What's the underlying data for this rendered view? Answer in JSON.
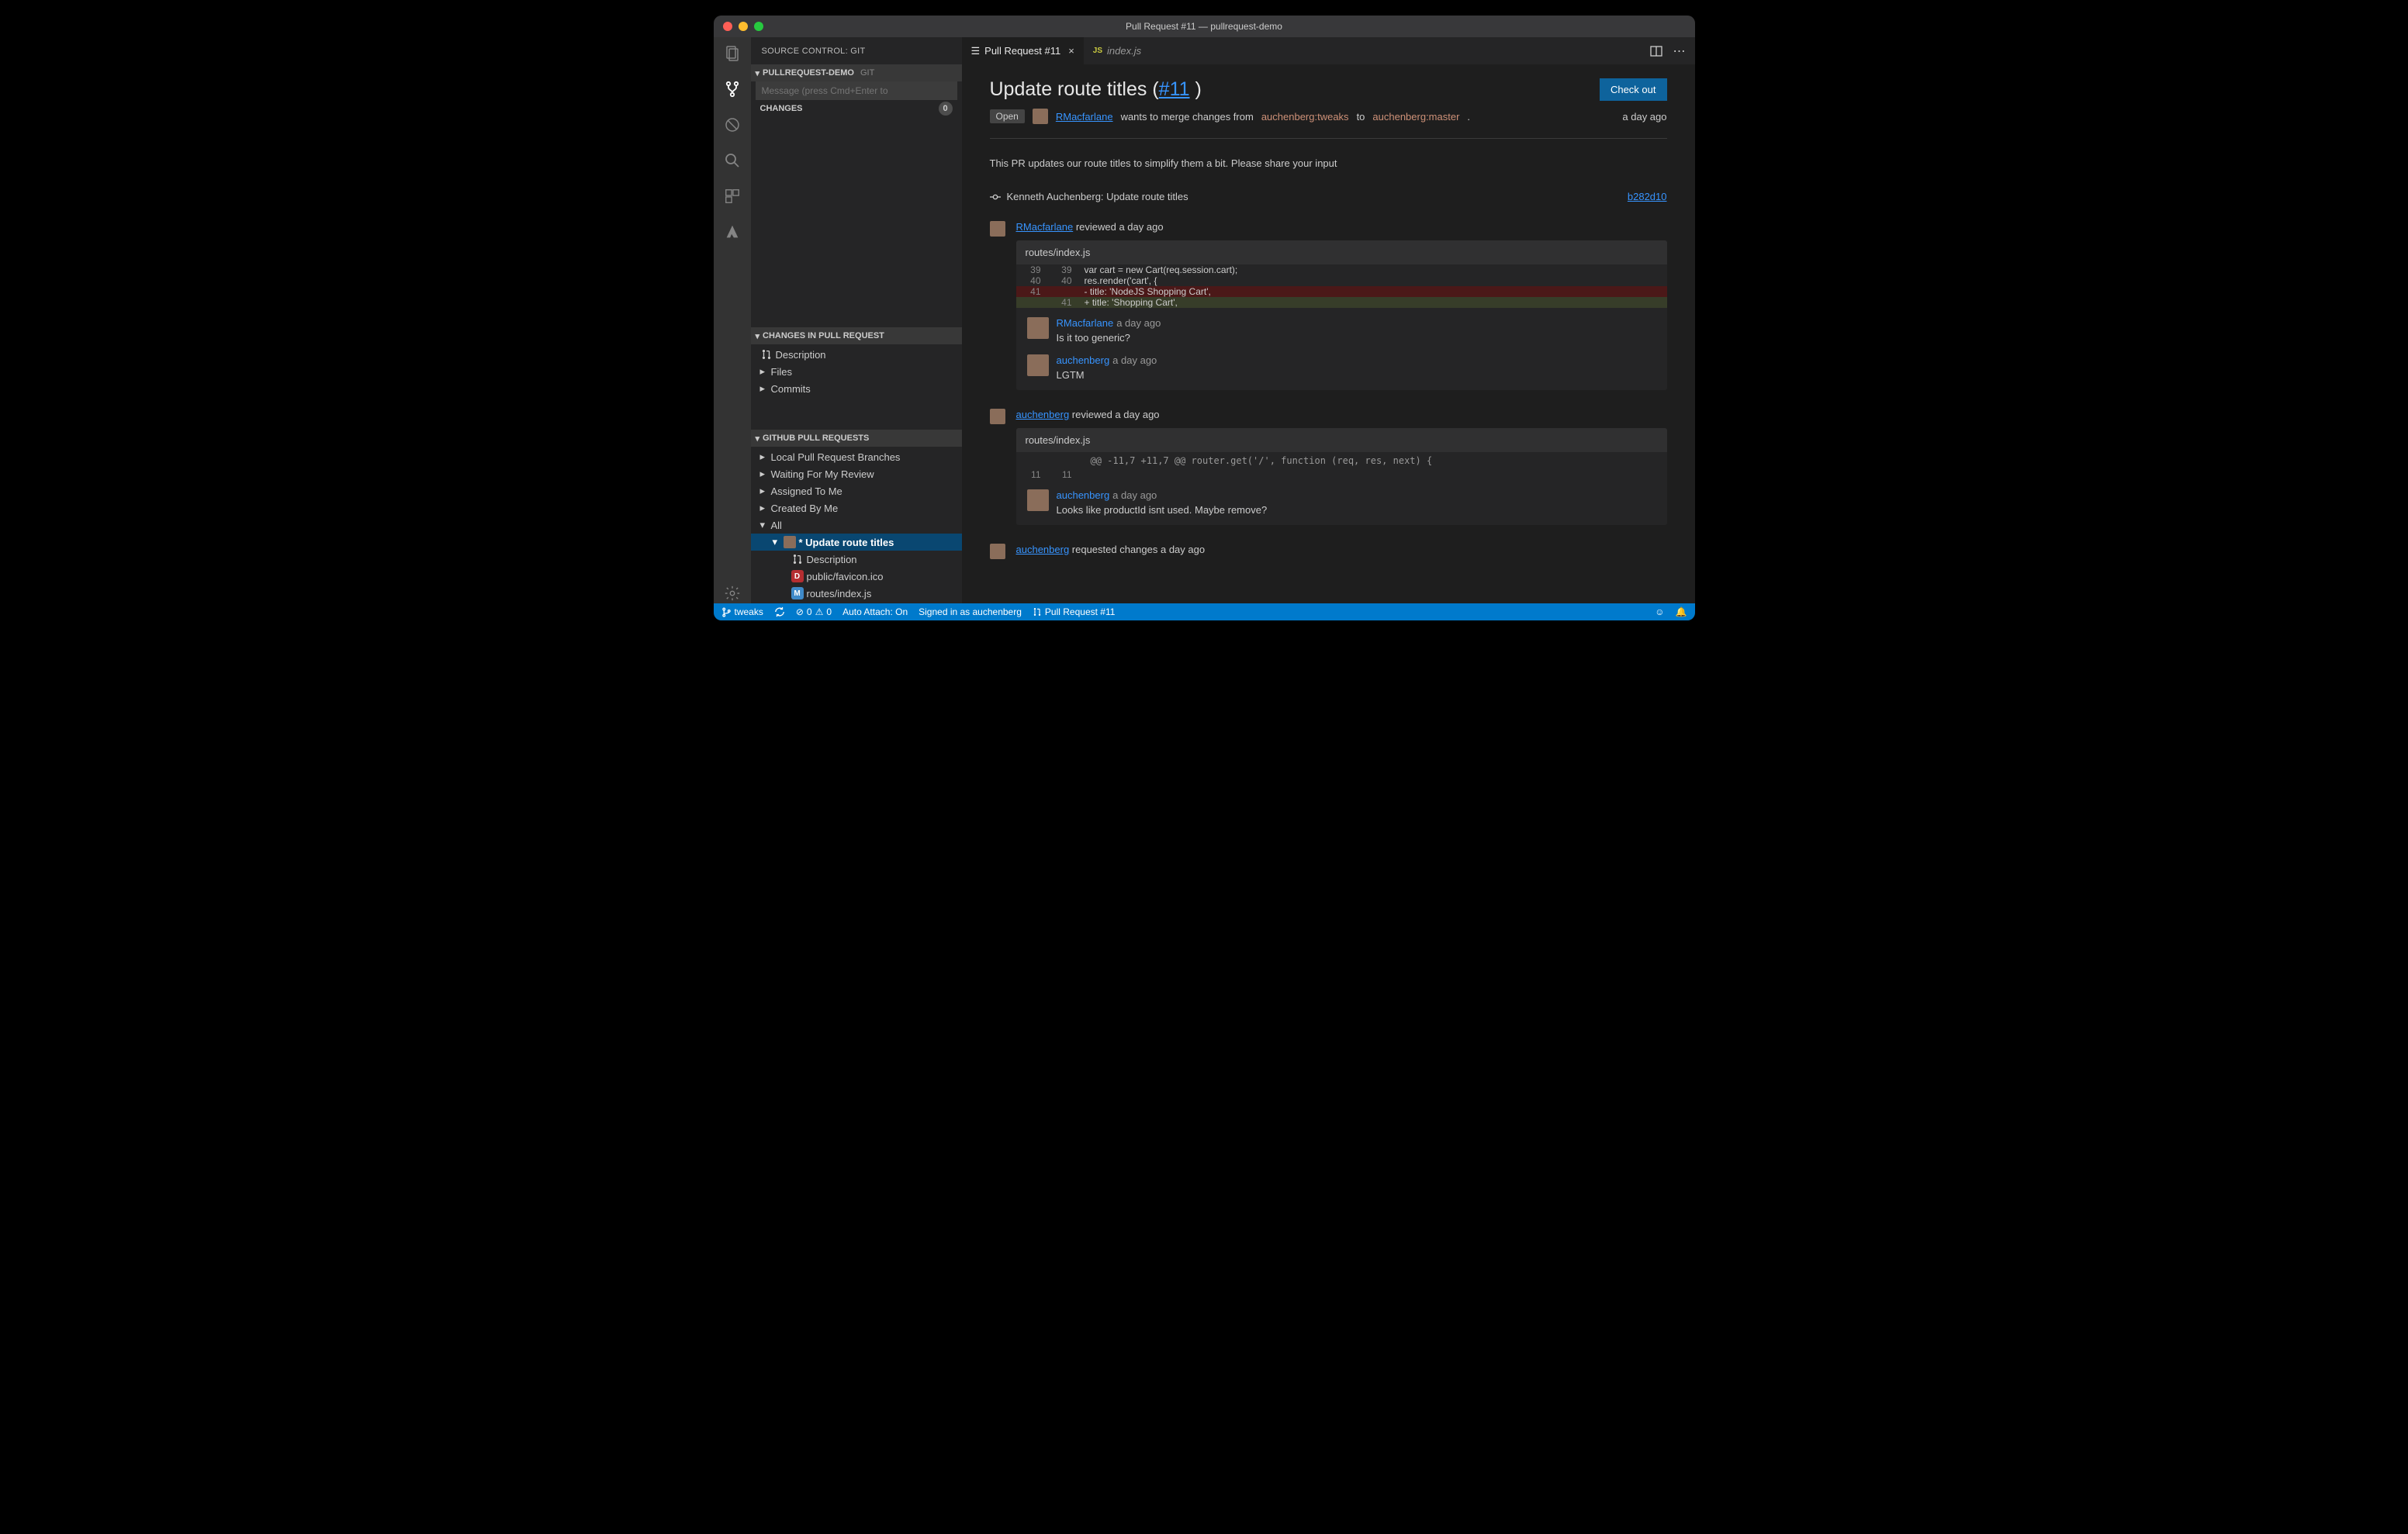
{
  "window": {
    "title": "Pull Request #11 — pullrequest-demo"
  },
  "sidebar": {
    "title": "SOURCE CONTROL: GIT",
    "repo": {
      "name": "PULLREQUEST-DEMO",
      "kind": "GIT"
    },
    "commit_placeholder": "Message (press Cmd+Enter to",
    "changes": {
      "label": "CHANGES",
      "count": "0"
    },
    "pr_section": "CHANGES IN PULL REQUEST",
    "pr_items": {
      "description": "Description",
      "files": "Files",
      "commits": "Commits"
    },
    "gh_section": "GITHUB PULL REQUESTS",
    "gh_items": {
      "local": "Local Pull Request Branches",
      "waiting": "Waiting For My Review",
      "assigned": "Assigned To Me",
      "created": "Created By Me",
      "all": "All",
      "selected": "* Update route titles",
      "selected_desc": "Description",
      "selected_file1": "public/favicon.ico",
      "selected_file2": "routes/index.js"
    }
  },
  "tabs": {
    "t1": "Pull Request #11",
    "t2": "index.js",
    "jslabel": "JS"
  },
  "pr": {
    "title_pre": "Update route titles (",
    "title_num": "#11",
    "title_post": " )",
    "checkout": "Check out",
    "state": "Open",
    "author": "RMacfarlane",
    "mergeline_a": " wants to merge changes from ",
    "branch_src": "auchenberg:tweaks",
    "mergeline_b": " to ",
    "branch_dst": "auchenberg:master",
    "dot": ".",
    "time": "a day ago",
    "description": "This PR updates our route titles to simplify them a bit. Please share your input",
    "commit_author": "Kenneth Auchenberg: Update route titles",
    "commit_sha": "b282d10",
    "review1": {
      "user": "RMacfarlane",
      "action": " reviewed a day ago",
      "file": "routes/index.js",
      "lines": {
        "l1o": "39",
        "l1n": "39",
        "l1c": "  var cart = new Cart(req.session.cart);",
        "l2o": "40",
        "l2n": "40",
        "l2c": "  res.render('cart', {",
        "l3o": "41",
        "l3c": "-     title: 'NodeJS Shopping Cart',",
        "l4n": "41",
        "l4c": "+     title: 'Shopping Cart',"
      },
      "comments": [
        {
          "user": "RMacfarlane",
          "when": "a day ago",
          "body": "Is it too generic?"
        },
        {
          "user": "auchenberg",
          "when": "a day ago",
          "body": "LGTM"
        }
      ]
    },
    "review2": {
      "user": "auchenberg",
      "action": " reviewed a day ago",
      "file": "routes/index.js",
      "hunk": "@@ -11,7 +11,7 @@ router.get('/', function (req, res, next) {",
      "l_o": "11",
      "l_n": "11",
      "comments": [
        {
          "user": "auchenberg",
          "when": "a day ago",
          "body": "Looks like productId isnt used. Maybe remove?"
        }
      ]
    },
    "review3": {
      "user": "auchenberg",
      "action": " requested changes a day ago"
    }
  },
  "status": {
    "branch": "tweaks",
    "errors": "0",
    "warnings": "0",
    "autoattach": "Auto Attach: On",
    "signedin": "Signed in as auchenberg",
    "pr": "Pull Request #11"
  }
}
